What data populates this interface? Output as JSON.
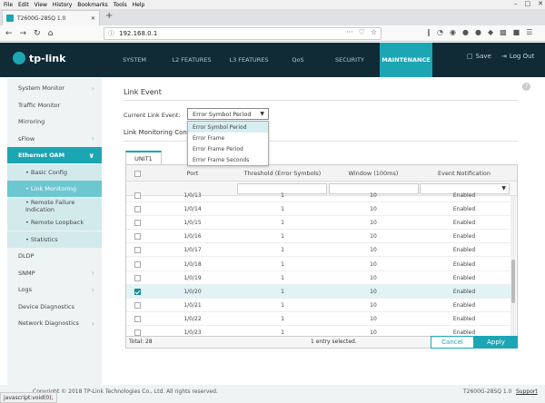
{
  "browser": {
    "menu": [
      "File",
      "Edit",
      "View",
      "History",
      "Bookmarks",
      "Tools",
      "Help"
    ],
    "window_buttons": [
      "–",
      "□",
      "✕"
    ],
    "tab_title": "T2600G-28SQ 1.0",
    "tab_close": "✕",
    "new_tab": "+",
    "url": "192.168.0.1",
    "status_text": "javascript:void(0);"
  },
  "header": {
    "logo_text": "tp-link",
    "nav": [
      "SYSTEM",
      "L2 FEATURES",
      "L3 FEATURES",
      "QoS",
      "SECURITY",
      "MAINTENANCE"
    ],
    "active_nav": "MAINTENANCE",
    "save_label": "Save",
    "logout_label": "Log Out"
  },
  "sidebar": {
    "items": [
      {
        "label": "System Monitor",
        "chevron": true
      },
      {
        "label": "Traffic Monitor",
        "chevron": false
      },
      {
        "label": "Mirroring",
        "chevron": false
      },
      {
        "label": "sFlow",
        "chevron": true
      },
      {
        "label": "Ethernet OAM",
        "chevron": true
      },
      {
        "label": "•  Basic Config",
        "sub": true
      },
      {
        "label": "•  Link Monitoring",
        "sub": true,
        "active": true
      },
      {
        "label": "•  Remote Failure Indication",
        "sub": true
      },
      {
        "label": "•  Remote Loopback",
        "sub": true
      },
      {
        "label": "•  Statistics",
        "sub": true
      },
      {
        "label": "DLDP",
        "chevron": false
      },
      {
        "label": "SNMP",
        "chevron": true
      },
      {
        "label": "Logs",
        "chevron": true
      },
      {
        "label": "Device Diagnostics",
        "chevron": false
      },
      {
        "label": "Network Diagnostics",
        "chevron": true
      }
    ]
  },
  "main": {
    "title": "Link Event",
    "current_link_event_label": "Current Link Event:",
    "current_link_event_value": "Error Symbol Period",
    "link_monitoring_title": "Link Monitoring Conf",
    "dropdown_options": [
      "Error Symbol Period",
      "Error Frame",
      "Error Frame Period",
      "Error Frame Seconds"
    ],
    "unit_tab": "UNIT1",
    "columns": [
      "Port",
      "Threshold (Error Symbols)",
      "Window (100ms)",
      "Event Notification"
    ],
    "rows": [
      {
        "port": "1/0/13",
        "threshold": "1",
        "window": "10",
        "notification": "Enabled",
        "checked": false
      },
      {
        "port": "1/0/14",
        "threshold": "1",
        "window": "10",
        "notification": "Enabled",
        "checked": false
      },
      {
        "port": "1/0/15",
        "threshold": "1",
        "window": "10",
        "notification": "Enabled",
        "checked": false
      },
      {
        "port": "1/0/16",
        "threshold": "1",
        "window": "10",
        "notification": "Enabled",
        "checked": false
      },
      {
        "port": "1/0/17",
        "threshold": "1",
        "window": "10",
        "notification": "Enabled",
        "checked": false
      },
      {
        "port": "1/0/18",
        "threshold": "1",
        "window": "10",
        "notification": "Enabled",
        "checked": false
      },
      {
        "port": "1/0/19",
        "threshold": "1",
        "window": "10",
        "notification": "Enabled",
        "checked": false
      },
      {
        "port": "1/0/20",
        "threshold": "1",
        "window": "10",
        "notification": "Enabled",
        "checked": true
      },
      {
        "port": "1/0/21",
        "threshold": "1",
        "window": "10",
        "notification": "Enabled",
        "checked": false
      },
      {
        "port": "1/0/22",
        "threshold": "1",
        "window": "10",
        "notification": "Enabled",
        "checked": false
      },
      {
        "port": "1/0/23",
        "threshold": "1",
        "window": "10",
        "notification": "Enabled",
        "checked": false
      }
    ],
    "total_label": "Total: 28",
    "selected_info": "1 entry selected.",
    "cancel_label": "Cancel",
    "apply_label": "Apply"
  },
  "footer": {
    "copyright": "Copyright © 2018 TP-Link Technologies Co., Ltd. All rights reserved.",
    "model": "T2600G-28SQ 1.0",
    "support": "Support"
  },
  "colors": {
    "accent": "#1ca6b4",
    "header_bg": "#102b36"
  }
}
